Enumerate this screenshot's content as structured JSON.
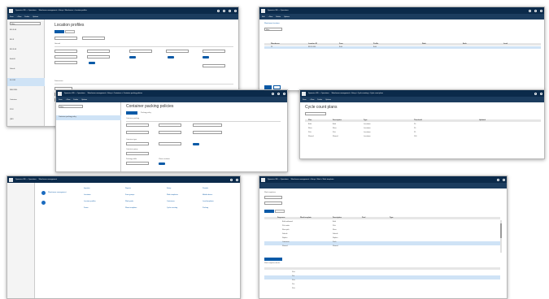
{
  "windows": {
    "w1": {
      "nav_title": "Dynamics 365 — Operations",
      "breadcrumb": "Warehouse management > Setup > Warehouse > Location profiles",
      "actions": [
        "Save",
        "+ New",
        "Delete",
        "Options"
      ],
      "page_title": "Location profiles",
      "filter_placeholder": "Filter",
      "list": [
        {
          "id": "BULK-06",
          "sub": "Bulk"
        },
        {
          "id": "BULK",
          "sub": "Bulk"
        },
        {
          "id": "BULK-06",
          "sub": "Bulk"
        },
        {
          "id": "Bulk-06",
          "sub": "Bulk"
        },
        {
          "id": "Default",
          "sub": "Default"
        },
        {
          "id": "FLOOR",
          "sub": "Floor"
        },
        {
          "id": "INBOUND",
          "sub": "Inbound"
        },
        {
          "id": "Container",
          "sub": "Container"
        },
        {
          "id": "PICK",
          "sub": "Picking"
        },
        {
          "id": "QMS",
          "sub": "Quality"
        }
      ],
      "general_label": "General",
      "dimensions_label": "Dimensions"
    },
    "w2": {
      "nav_title": "Dynamics 365 — Operations",
      "actions": [
        "Edit",
        "+ New",
        "Delete",
        "Options"
      ],
      "page_title": "Warehouse locations",
      "filter_label": "Filter",
      "columns": [
        "Warehouse",
        "Location ID",
        "Zone",
        "Profile",
        "Rack",
        "Aisle",
        "Level"
      ],
      "rows": [
        {
          "c1": "24",
          "c2": "BULK-006",
          "c3": "Bulk",
          "c4": "Bulk"
        }
      ],
      "footer_button": "Save"
    },
    "w3": {
      "nav_title": "Dynamics 365 — Operations",
      "breadcrumb": "Warehouse management > Setup > Containers > Container packing policies",
      "actions": [
        "Save",
        "+ New",
        "Delete",
        "Options"
      ],
      "page_title": "Container packing policies",
      "filter_placeholder": "Filter",
      "list_item": "Container packing policy",
      "tabs": [
        "Overview",
        "Packing policy"
      ],
      "section": "Container packing",
      "fields": [
        "Container type",
        "Container group",
        "Packing profile",
        "Close container"
      ]
    },
    "w4": {
      "nav_title": "Dynamics 365 — Operations",
      "breadcrumb": "Warehouse management > Setup > Cycle counting > Cycle count plans",
      "actions": [
        "Save",
        "+ New",
        "Delete",
        "Options"
      ],
      "page_title": "Cycle count plans",
      "columns": [
        "Plan",
        "Description",
        "Type",
        "Threshold",
        "Updated"
      ],
      "rows": [
        {
          "c1": "Bulk",
          "c2": "Bulk",
          "c3": "Locations",
          "c4": "20"
        },
        {
          "c1": "Floor",
          "c2": "Floor",
          "c3": "Locations",
          "c4": "20"
        },
        {
          "c1": "Pick",
          "c2": "Pick",
          "c3": "Locations",
          "c4": "25"
        },
        {
          "c1": "Shared",
          "c2": "Shared",
          "c3": "Locations",
          "c4": "100"
        }
      ]
    },
    "w5": {
      "nav_title": "Dynamics 365 — Operations",
      "breadcrumb": "Warehouse management",
      "workspace_title": "Warehouse management",
      "col_heads": [
        "Inquiries",
        "Reports",
        "Setup",
        "Periodic"
      ],
      "links": [
        "Locations",
        "Location profiles",
        "Zones",
        "Zone groups",
        "Work pools",
        "Wave templates",
        "Work templates",
        "Containers",
        "Cycle counting",
        "Mobile device",
        "Load templates",
        "Packing"
      ]
    },
    "w6": {
      "nav_title": "Dynamics 365 — Operations",
      "breadcrumb": "Warehouse management > Setup > Work > Work templates",
      "page_title": "Work templates",
      "tabs": [
        "Overview",
        "Details"
      ],
      "columns": [
        "Sequence",
        "Work template",
        "Description",
        "Pool",
        "Type"
      ],
      "rows": [
        {
          "c1": "1",
          "c2": "Bulk outbound",
          "c3": "Bulk"
        },
        {
          "c1": "2",
          "c2": "Pick order",
          "c3": "Pick"
        },
        {
          "c1": "3",
          "c2": "Floor pick",
          "c3": "Floor"
        },
        {
          "c1": "4",
          "c2": "Default",
          "c3": "Default"
        },
        {
          "c1": "5",
          "c2": "Replen",
          "c3": "Replen"
        },
        {
          "c1": "6",
          "c2": "Container",
          "c3": "Pack"
        },
        {
          "c1": "7",
          "c2": "Shared",
          "c3": "Shared"
        }
      ],
      "lines_title": "Work template details",
      "lines": [
        "Pick",
        "Put",
        "Pick",
        "Put",
        "Pick"
      ]
    }
  }
}
